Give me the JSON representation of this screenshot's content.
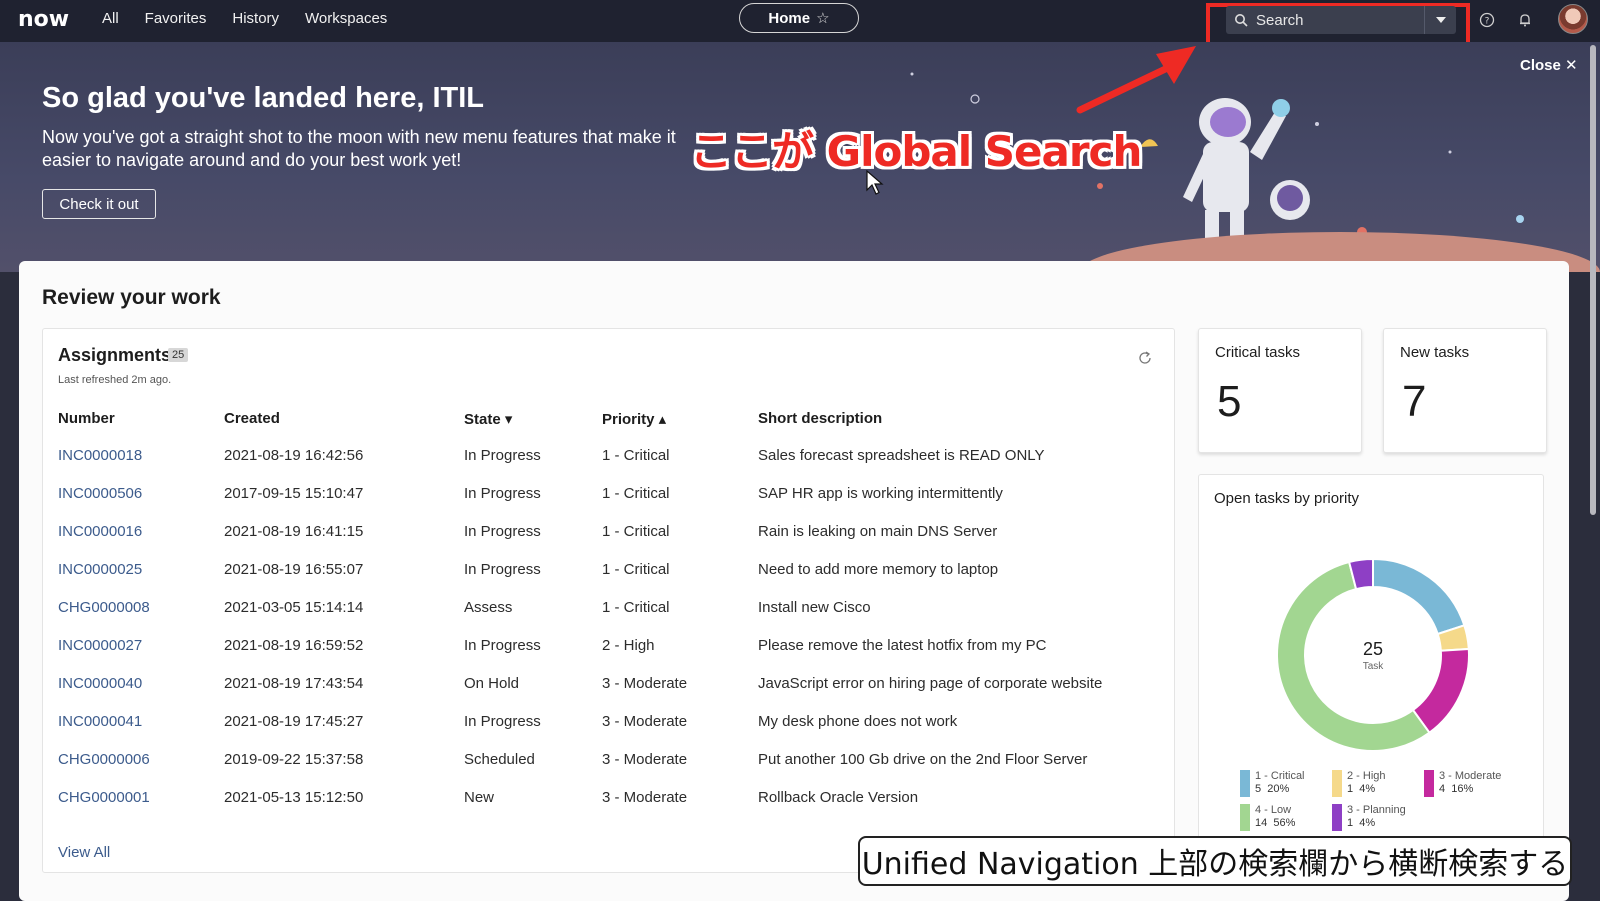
{
  "nav": {
    "logo": "now",
    "links": [
      "All",
      "Favorites",
      "History",
      "Workspaces"
    ],
    "home_label": "Home",
    "search_placeholder": "Search"
  },
  "hero": {
    "title": "So glad you've landed here, ITIL",
    "text": "Now you've got a straight shot to the moon with new menu features that make it easier to navigate around and do your best work yet!",
    "button": "Check it out",
    "close": "Close ✕",
    "callout": "ここが Global Search"
  },
  "review": {
    "title": "Review your work"
  },
  "assignments": {
    "title": "Assignments",
    "count": "25",
    "refreshed": "Last refreshed 2m ago.",
    "columns": [
      "Number",
      "Created",
      "State ▾",
      "Priority ▴",
      "Short description"
    ],
    "rows": [
      [
        "INC0000018",
        "2021-08-19 16:42:56",
        "In Progress",
        "1 - Critical",
        "Sales forecast spreadsheet is READ ONLY"
      ],
      [
        "INC0000506",
        "2017-09-15 15:10:47",
        "In Progress",
        "1 - Critical",
        "SAP HR app is working intermittently"
      ],
      [
        "INC0000016",
        "2021-08-19 16:41:15",
        "In Progress",
        "1 - Critical",
        "Rain is leaking on main DNS Server"
      ],
      [
        "INC0000025",
        "2021-08-19 16:55:07",
        "In Progress",
        "1 - Critical",
        "Need to add more memory to laptop"
      ],
      [
        "CHG0000008",
        "2021-03-05 15:14:14",
        "Assess",
        "1 - Critical",
        "Install new Cisco"
      ],
      [
        "INC0000027",
        "2021-08-19 16:59:52",
        "In Progress",
        "2 - High",
        "Please remove the latest hotfix from my PC"
      ],
      [
        "INC0000040",
        "2021-08-19 17:43:54",
        "On Hold",
        "3 - Moderate",
        "JavaScript error on hiring page of corporate website"
      ],
      [
        "INC0000041",
        "2021-08-19 17:45:27",
        "In Progress",
        "3 - Moderate",
        "My desk phone does not work"
      ],
      [
        "CHG0000006",
        "2019-09-22 15:37:58",
        "Scheduled",
        "3 - Moderate",
        "Put another 100 Gb drive on the 2nd Floor Server"
      ],
      [
        "CHG0000001",
        "2021-05-13 15:12:50",
        "New",
        "3 - Moderate",
        "Rollback Oracle Version"
      ]
    ],
    "view_all": "View All"
  },
  "kpis": [
    {
      "label": "Critical tasks",
      "value": "5"
    },
    {
      "label": "New tasks",
      "value": "7"
    }
  ],
  "donut": {
    "title": "Open tasks by priority",
    "center_value": "25",
    "center_label": "Task"
  },
  "chart_data": {
    "type": "pie",
    "title": "Open tasks by priority",
    "total": 25,
    "series": [
      {
        "name": "1 - Critical",
        "value": 5,
        "percent": "20%",
        "color": "#7ab8d6"
      },
      {
        "name": "2 - High",
        "value": 1,
        "percent": "4%",
        "color": "#f5d98a"
      },
      {
        "name": "3 - Moderate",
        "value": 4,
        "percent": "16%",
        "color": "#c4299e"
      },
      {
        "name": "4 - Low",
        "value": 14,
        "percent": "56%",
        "color": "#a2d691"
      },
      {
        "name": "3 - Planning",
        "value": 1,
        "percent": "4%",
        "color": "#8e3fc5"
      }
    ]
  },
  "caption": "Unified Navigation 上部の検索欄から横断検索する"
}
